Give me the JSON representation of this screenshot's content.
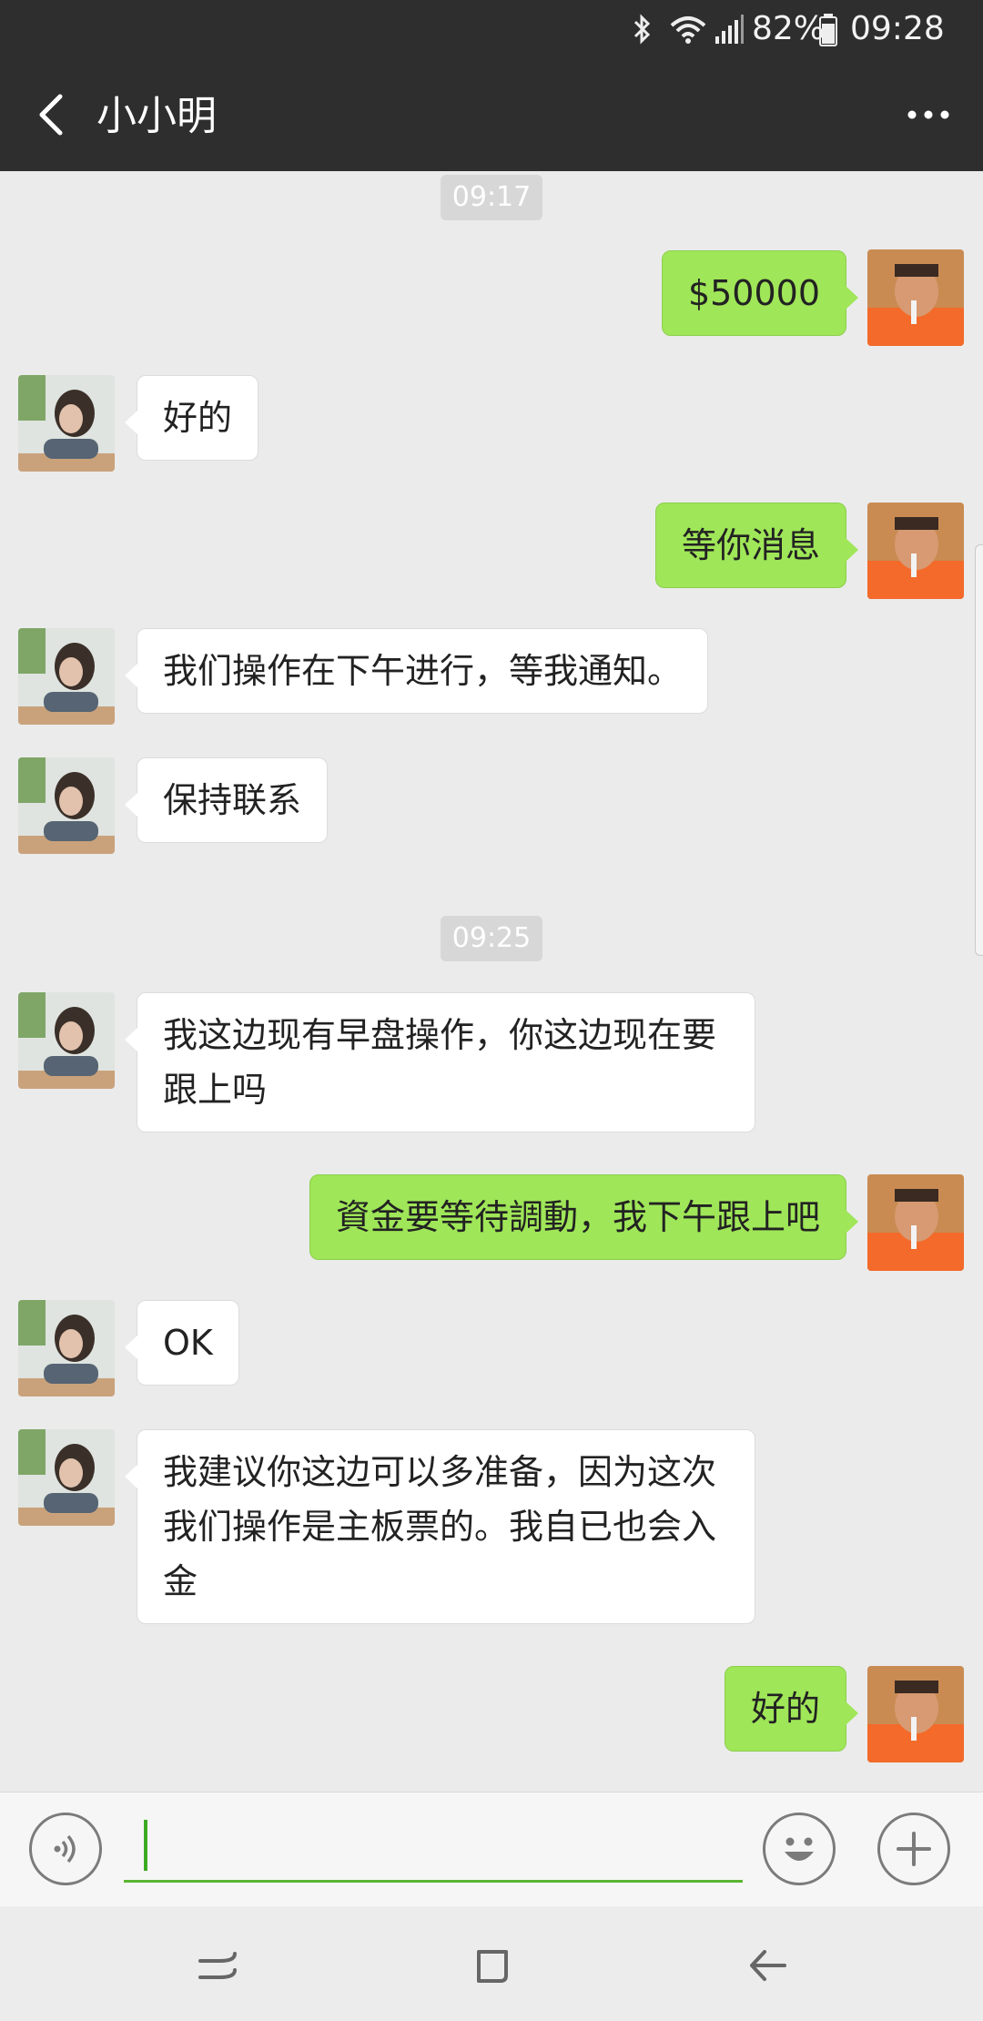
{
  "status_bar": {
    "battery": "82%",
    "time": "09:28"
  },
  "header": {
    "title": "小小明"
  },
  "messages": [
    {
      "kind": "time",
      "text": "09:17"
    },
    {
      "kind": "out",
      "text": "$50000"
    },
    {
      "kind": "in",
      "text": "好的"
    },
    {
      "kind": "out",
      "text": "等你消息"
    },
    {
      "kind": "in",
      "text": "我们操作在下午进行，等我通知。"
    },
    {
      "kind": "in",
      "text": "保持联系"
    },
    {
      "kind": "time",
      "text": "09:25"
    },
    {
      "kind": "in",
      "text": "我这边现有早盘操作，你这边现在要跟上吗"
    },
    {
      "kind": "out",
      "text": "資金要等待調動，我下午跟上吧"
    },
    {
      "kind": "in",
      "text": "OK"
    },
    {
      "kind": "in",
      "text": "我建议你这边可以多准备，因为这次我们操作是主板票的。我自已也会入金"
    },
    {
      "kind": "out",
      "text": "好的"
    }
  ],
  "input_bar": {
    "value": ""
  },
  "icons": {
    "status": [
      "bluetooth-icon",
      "wifi-icon",
      "signal-icon",
      "battery-icon"
    ],
    "header": [
      "back-arrow-icon",
      "more-dots-icon"
    ],
    "input": [
      "voice-icon",
      "emoji-icon",
      "plus-icon"
    ],
    "nav": [
      "recent-apps-icon",
      "home-icon",
      "back-icon"
    ]
  },
  "colors": {
    "header_bg": "#2e2e2e",
    "chat_bg": "#ebebeb",
    "outgoing_bubble": "#9fe658",
    "incoming_bubble": "#ffffff",
    "input_accent": "#5ab533"
  }
}
